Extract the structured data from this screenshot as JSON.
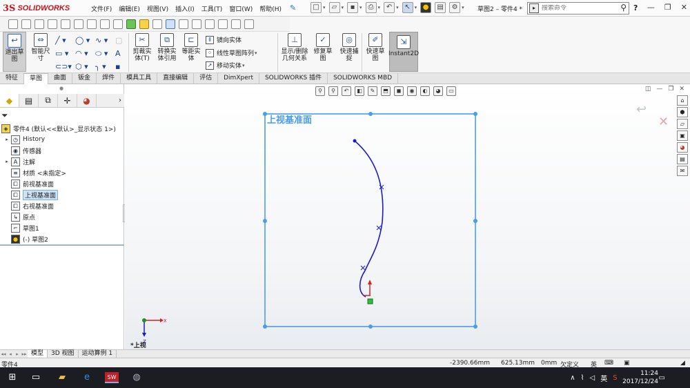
{
  "app": {
    "logo_text": "SOLIDWORKS",
    "menu": [
      "文件(F)",
      "编辑(E)",
      "视图(V)",
      "插入(I)",
      "工具(T)",
      "窗口(W)",
      "帮助(H)"
    ],
    "doc_title": "草图2 – 零件4 *",
    "search_placeholder": "搜索命令",
    "help_label": "?"
  },
  "ribbon": {
    "exit_sketch": "退出草图",
    "smart_dim": "智能尺寸",
    "trim": "剪裁实体(T)",
    "convert": "转换实体引用",
    "offset": "等距实体",
    "mirror": "镜向实体",
    "linear_pattern": "线性草图阵列",
    "move": "移动实体",
    "show_relations": "显示/删除几何关系",
    "repair": "修复草图",
    "quick_snaps": "快速捕捉",
    "rapid_sketch": "快速草图",
    "instant2d": "Instant2D"
  },
  "tabs": [
    "特征",
    "草图",
    "曲面",
    "钣金",
    "焊件",
    "模具工具",
    "直接编辑",
    "评估",
    "DimXpert",
    "SOLIDWORKS 插件",
    "SOLIDWORKS MBD"
  ],
  "active_tab": "草图",
  "tree": {
    "root": "零件4 (默认<<默认>_显示状态 1>)",
    "items": [
      {
        "label": "History",
        "expandable": true
      },
      {
        "label": "传感器",
        "expandable": false
      },
      {
        "label": "注解",
        "expandable": true
      },
      {
        "label": "材质 <未指定>",
        "expandable": false
      },
      {
        "label": "前视基准面",
        "expandable": false
      },
      {
        "label": "上视基准面",
        "expandable": false,
        "selected": true
      },
      {
        "label": "右视基准面",
        "expandable": false
      },
      {
        "label": "原点",
        "expandable": false
      },
      {
        "label": "草图1",
        "expandable": false
      },
      {
        "label": "(-) 草图2",
        "expandable": false
      }
    ]
  },
  "graphics": {
    "plane_label": "上视基准面",
    "view_label": "*上视",
    "triad_axis_z": "Z",
    "triad_axis_x": "X"
  },
  "model_tabs": [
    "模型",
    "3D 视图",
    "运动算例 1"
  ],
  "status": {
    "doc": "零件4",
    "x": "-2390.66mm",
    "y": "625.13mm",
    "z": "0mm",
    "state": "欠定义",
    "ime": "英"
  },
  "taskbar": {
    "time": "11:24",
    "date": "2017/12/24",
    "ime": "英"
  }
}
